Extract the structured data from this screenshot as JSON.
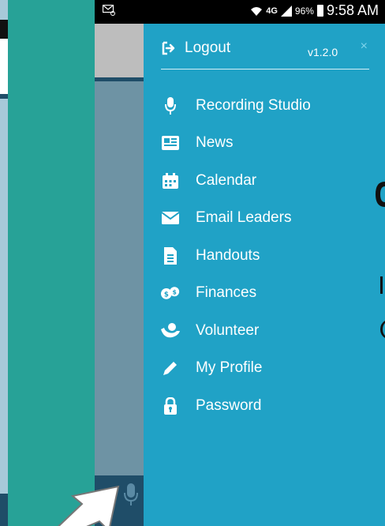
{
  "status_bar": {
    "network": "4G",
    "battery": "96%",
    "time": "9:58 AM"
  },
  "drawer": {
    "logout_label": "Logout",
    "version": "v1.2.0",
    "close_symbol": "×",
    "items": [
      {
        "label": "Recording Studio",
        "icon": "microphone-icon"
      },
      {
        "label": "News",
        "icon": "newspaper-icon"
      },
      {
        "label": "Calendar",
        "icon": "calendar-icon"
      },
      {
        "label": "Email Leaders",
        "icon": "envelope-icon"
      },
      {
        "label": "Handouts",
        "icon": "document-icon"
      },
      {
        "label": "Finances",
        "icon": "coins-icon"
      },
      {
        "label": "Volunteer",
        "icon": "volunteer-icon"
      },
      {
        "label": "My Profile",
        "icon": "pencil-icon"
      },
      {
        "label": "Password",
        "icon": "lock-icon"
      }
    ]
  },
  "colors": {
    "drawer_bg": "#20a2c6",
    "teal_bg": "#27a297",
    "dark_navy": "#1f4d68",
    "mid_gray_blue": "#6e93a4"
  }
}
